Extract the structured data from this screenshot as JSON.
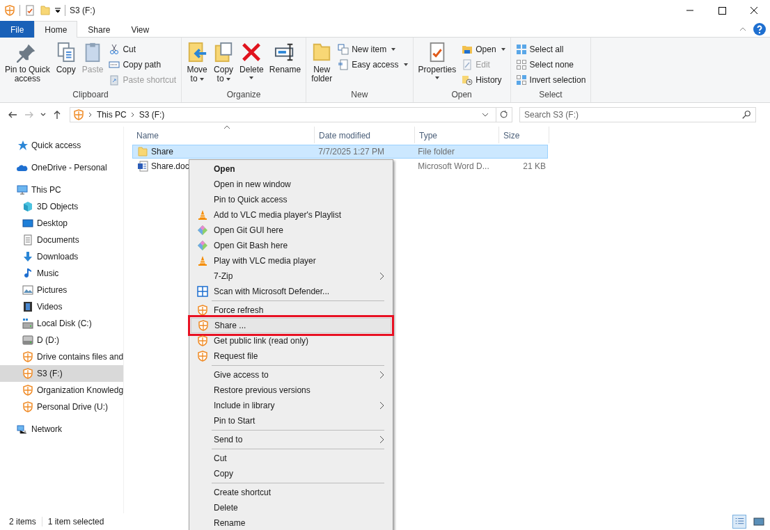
{
  "window": {
    "title": "S3 (F:)"
  },
  "ribbon": {
    "tabs": [
      {
        "label": "File",
        "kind": "file",
        "selected": false
      },
      {
        "label": "Home",
        "kind": "tab",
        "selected": true
      },
      {
        "label": "Share",
        "kind": "tab",
        "selected": false
      },
      {
        "label": "View",
        "kind": "tab",
        "selected": false
      }
    ],
    "groups": [
      {
        "label": "Clipboard",
        "columns": [
          {
            "kind": "large",
            "label": "Pin to Quick\naccess",
            "disabled": false,
            "dropdown": false
          },
          {
            "kind": "large",
            "label": "Copy",
            "disabled": false,
            "dropdown": false
          },
          {
            "kind": "large",
            "label": "Paste",
            "disabled": true,
            "dropdown": false
          },
          {
            "kind": "stack",
            "items": [
              {
                "label": "Cut",
                "disabled": false,
                "dropdown": false
              },
              {
                "label": "Copy path",
                "disabled": false,
                "dropdown": false
              },
              {
                "label": "Paste shortcut",
                "disabled": true,
                "dropdown": false
              }
            ]
          }
        ]
      },
      {
        "label": "Organize",
        "columns": [
          {
            "kind": "large",
            "label": "Move\nto",
            "disabled": false,
            "dropdown": true
          },
          {
            "kind": "large",
            "label": "Copy\nto",
            "disabled": false,
            "dropdown": true
          },
          {
            "kind": "large",
            "label": "Delete",
            "disabled": false,
            "dropdown": true
          },
          {
            "kind": "large",
            "label": "Rename",
            "disabled": false,
            "dropdown": false
          }
        ]
      },
      {
        "label": "New",
        "columns": [
          {
            "kind": "large",
            "label": "New\nfolder",
            "disabled": false,
            "dropdown": false
          },
          {
            "kind": "stack",
            "items": [
              {
                "label": "New item",
                "disabled": false,
                "dropdown": true
              },
              {
                "label": "Easy access",
                "disabled": false,
                "dropdown": true
              }
            ]
          }
        ]
      },
      {
        "label": "Open",
        "columns": [
          {
            "kind": "large",
            "label": "Properties",
            "disabled": false,
            "dropdown": true
          },
          {
            "kind": "stack",
            "items": [
              {
                "label": "Open",
                "disabled": false,
                "dropdown": true
              },
              {
                "label": "Edit",
                "disabled": true,
                "dropdown": false
              },
              {
                "label": "History",
                "disabled": false,
                "dropdown": false
              }
            ]
          }
        ]
      },
      {
        "label": "Select",
        "columns": [
          {
            "kind": "stack",
            "items": [
              {
                "label": "Select all",
                "disabled": false,
                "dropdown": false
              },
              {
                "label": "Select none",
                "disabled": false,
                "dropdown": false
              },
              {
                "label": "Invert selection",
                "disabled": false,
                "dropdown": false
              }
            ]
          }
        ]
      }
    ]
  },
  "navigation": [
    {
      "kind": "back",
      "disabled": false
    },
    {
      "kind": "forward",
      "disabled": true
    },
    {
      "kind": "recent",
      "disabled": false
    },
    {
      "kind": "up",
      "disabled": false
    }
  ],
  "address_bar": {
    "path": [
      "This PC",
      "S3 (F:)"
    ]
  },
  "search": {
    "placeholder": "Search S3 (F:)"
  },
  "sidebar": {
    "items": [
      {
        "label": "Quick access",
        "selected": false
      },
      {
        "label": "OneDrive - Personal",
        "selected": false
      },
      {
        "label": "This PC",
        "selected": false,
        "children": [
          {
            "label": "3D Objects",
            "selected": false
          },
          {
            "label": "Desktop",
            "selected": false
          },
          {
            "label": "Documents",
            "selected": false
          },
          {
            "label": "Downloads",
            "selected": false
          },
          {
            "label": "Music",
            "selected": false
          },
          {
            "label": "Pictures",
            "selected": false
          },
          {
            "label": "Videos",
            "selected": false
          },
          {
            "label": "Local Disk (C:)",
            "selected": false
          },
          {
            "label": "D (D:)",
            "selected": false
          },
          {
            "label": "Drive contains files and",
            "selected": false
          },
          {
            "label": "S3 (F:)",
            "selected": true
          },
          {
            "label": "Organization Knowledg",
            "selected": false
          },
          {
            "label": "Personal Drive (U:)",
            "selected": false
          }
        ]
      },
      {
        "label": "Network",
        "selected": false
      }
    ]
  },
  "file_list": {
    "columns": [
      {
        "label": "Name",
        "sorted": true
      },
      {
        "label": "Date modified",
        "sorted": false
      },
      {
        "label": "Type",
        "sorted": false
      },
      {
        "label": "Size",
        "sorted": false
      }
    ],
    "rows": [
      {
        "kind": "folder",
        "name": "Share",
        "date": "7/7/2025 1:27 PM",
        "type": "File folder",
        "selected": true
      },
      {
        "kind": "document",
        "name": "Share.doc",
        "type": "Microsoft Word D...",
        "size": "21 KB",
        "selected": false
      }
    ]
  },
  "context_menu": {
    "items": [
      {
        "kind": "item",
        "label": "Open",
        "default": true,
        "submenu": false,
        "highlighted": false
      },
      {
        "kind": "item",
        "label": "Open in new window",
        "default": false,
        "submenu": false,
        "highlighted": false
      },
      {
        "kind": "item",
        "label": "Pin to Quick access",
        "default": false,
        "submenu": false,
        "highlighted": false
      },
      {
        "kind": "item",
        "label": "Add to VLC media player's Playlist",
        "default": false,
        "submenu": false,
        "highlighted": false
      },
      {
        "kind": "item",
        "label": "Open Git GUI here",
        "default": false,
        "submenu": false,
        "highlighted": false
      },
      {
        "kind": "item",
        "label": "Open Git Bash here",
        "default": false,
        "submenu": false,
        "highlighted": false
      },
      {
        "kind": "item",
        "label": "Play with VLC media player",
        "default": false,
        "submenu": false,
        "highlighted": false
      },
      {
        "kind": "item",
        "label": "7-Zip",
        "default": false,
        "submenu": true,
        "highlighted": false
      },
      {
        "kind": "item",
        "label": "Scan with Microsoft Defender...",
        "default": false,
        "submenu": false,
        "highlighted": false
      },
      {
        "kind": "separator"
      },
      {
        "kind": "item",
        "label": "Force refresh",
        "default": false,
        "submenu": false,
        "highlighted": false
      },
      {
        "kind": "item",
        "label": "Share ...",
        "default": false,
        "submenu": false,
        "highlighted": true
      },
      {
        "kind": "item",
        "label": "Get public link (read only)",
        "default": false,
        "submenu": false,
        "highlighted": false
      },
      {
        "kind": "item",
        "label": "Request file",
        "default": false,
        "submenu": false,
        "highlighted": false
      },
      {
        "kind": "separator"
      },
      {
        "kind": "item",
        "label": "Give access to",
        "default": false,
        "submenu": true,
        "highlighted": false
      },
      {
        "kind": "item",
        "label": "Restore previous versions",
        "default": false,
        "submenu": false,
        "highlighted": false
      },
      {
        "kind": "item",
        "label": "Include in library",
        "default": false,
        "submenu": true,
        "highlighted": false
      },
      {
        "kind": "item",
        "label": "Pin to Start",
        "default": false,
        "submenu": false,
        "highlighted": false
      },
      {
        "kind": "separator"
      },
      {
        "kind": "item",
        "label": "Send to",
        "default": false,
        "submenu": true,
        "highlighted": false
      },
      {
        "kind": "separator"
      },
      {
        "kind": "item",
        "label": "Cut",
        "default": false,
        "submenu": false,
        "highlighted": false
      },
      {
        "kind": "item",
        "label": "Copy",
        "default": false,
        "submenu": false,
        "highlighted": false
      },
      {
        "kind": "separator"
      },
      {
        "kind": "item",
        "label": "Create shortcut",
        "default": false,
        "submenu": false,
        "highlighted": false
      },
      {
        "kind": "item",
        "label": "Delete",
        "default": false,
        "submenu": false,
        "highlighted": false
      },
      {
        "kind": "item",
        "label": "Rename",
        "default": false,
        "submenu": false,
        "highlighted": false
      }
    ]
  },
  "status_bar": {
    "item_count": "2 items",
    "selection": "1 item selected",
    "views": [
      {
        "selected": true
      },
      {
        "selected": false
      }
    ]
  }
}
